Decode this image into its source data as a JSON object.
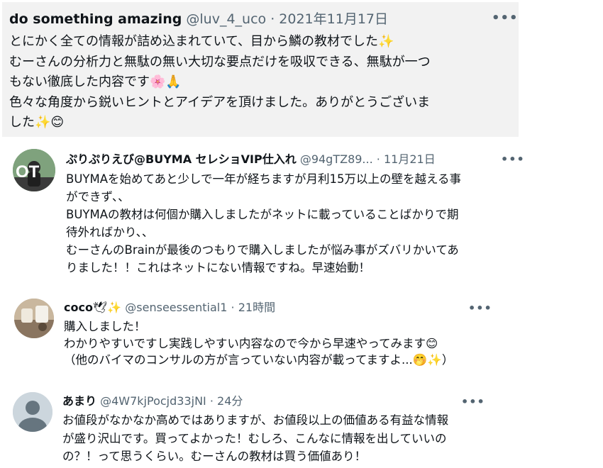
{
  "tweets": [
    {
      "name": "do something amazing",
      "handle": "@luv_4_uco",
      "dot": "·",
      "time": "2021年11月17日",
      "more": "•••",
      "lines": [
        "とにかく全ての情報が詰め込まれていて、目から鱗の教材でした✨",
        "むーさんの分析力と無駄の無い大切な要点だけを吸収できる、無駄が一つ",
        "もない徹底した内容です🌸🙏",
        "色々な角度から鋭いヒントとアイデアを頂けました。ありがとうございま",
        "した✨😊"
      ]
    },
    {
      "name": "ぷりぷりえび@BUYMA セレショVIP仕入れ",
      "handle": "@94gTZ89...",
      "dot": "·",
      "time": "11月21日",
      "more": "•••",
      "avatar_text": "OT",
      "lines": [
        "BUYMAを始めてあと少しで一年が経ちますが月利15万以上の壁を越える事",
        "ができず、、",
        "BUYMAの教材は何個か購入しましたがネットに載っていることばかりで期",
        "待外ればかり、、",
        "むーさんのBrainが最後のつもりで購入しましたが悩み事がズバリかいてあ",
        "りました！！これはネットにない情報ですね。早速始動！"
      ]
    },
    {
      "name": "coco",
      "name_emoji": "🕊✨",
      "handle": "@senseessential1",
      "dot": "·",
      "time": "21時間",
      "more": "•••",
      "lines": [
        "購入しました！",
        "わかりやすいですし実践しやすい内容なので今から早速やってみます😊",
        "（他のバイマのコンサルの方が言っていない内容が載ってますよ...🤭✨）"
      ]
    },
    {
      "name": "あまり",
      "handle": "@4W7kjPocjd33jNI",
      "dot": "·",
      "time": "24分",
      "more": "•••",
      "lines": [
        "お値段がなかなか高めではありますが、お値段以上の価値ある有益な情報",
        "が盛り沢山です。買ってよかった！むしろ、こんなに情報を出していいの",
        "の？！って思うくらい。むーさんの教材は買う価値あり！"
      ]
    }
  ]
}
